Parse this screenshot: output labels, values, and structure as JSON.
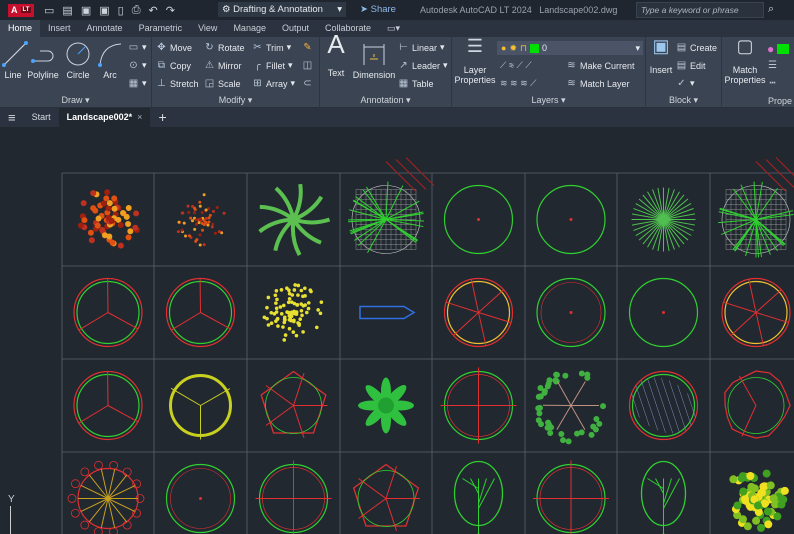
{
  "app": {
    "logo": "A",
    "edition": "LT",
    "workspace": "Drafting & Annotation",
    "share": "Share",
    "title": "Autodesk AutoCAD LT 2024",
    "file": "Landscape002.dwg",
    "search_placeholder": "Type a keyword or phrase"
  },
  "tabs": [
    "Home",
    "Insert",
    "Annotate",
    "Parametric",
    "View",
    "Manage",
    "Output",
    "Collaborate"
  ],
  "draw": {
    "label": "Draw",
    "line": "Line",
    "polyline": "Polyline",
    "circle": "Circle",
    "arc": "Arc"
  },
  "modify": {
    "label": "Modify",
    "move": "Move",
    "rotate": "Rotate",
    "trim": "Trim",
    "copy": "Copy",
    "mirror": "Mirror",
    "fillet": "Fillet",
    "stretch": "Stretch",
    "scale": "Scale",
    "array": "Array"
  },
  "annotation": {
    "label": "Annotation",
    "text": "Text",
    "dimension": "Dimension",
    "linear": "Linear",
    "leader": "Leader",
    "table": "Table"
  },
  "layers": {
    "label": "Layers",
    "layer_properties_1": "Layer",
    "layer_properties_2": "Properties",
    "current_layer": "0",
    "make_current": "Make Current",
    "match_layer": "Match Layer",
    "color": "#00e000"
  },
  "block": {
    "label": "Block",
    "insert": "Insert",
    "create": "Create",
    "edit": "Edit"
  },
  "properties": {
    "label": "Prope",
    "match_1": "Match",
    "match_2": "Properties"
  },
  "file_tabs": {
    "start": "Start",
    "current": "Landscape002*"
  },
  "ucs": {
    "y": "Y"
  }
}
